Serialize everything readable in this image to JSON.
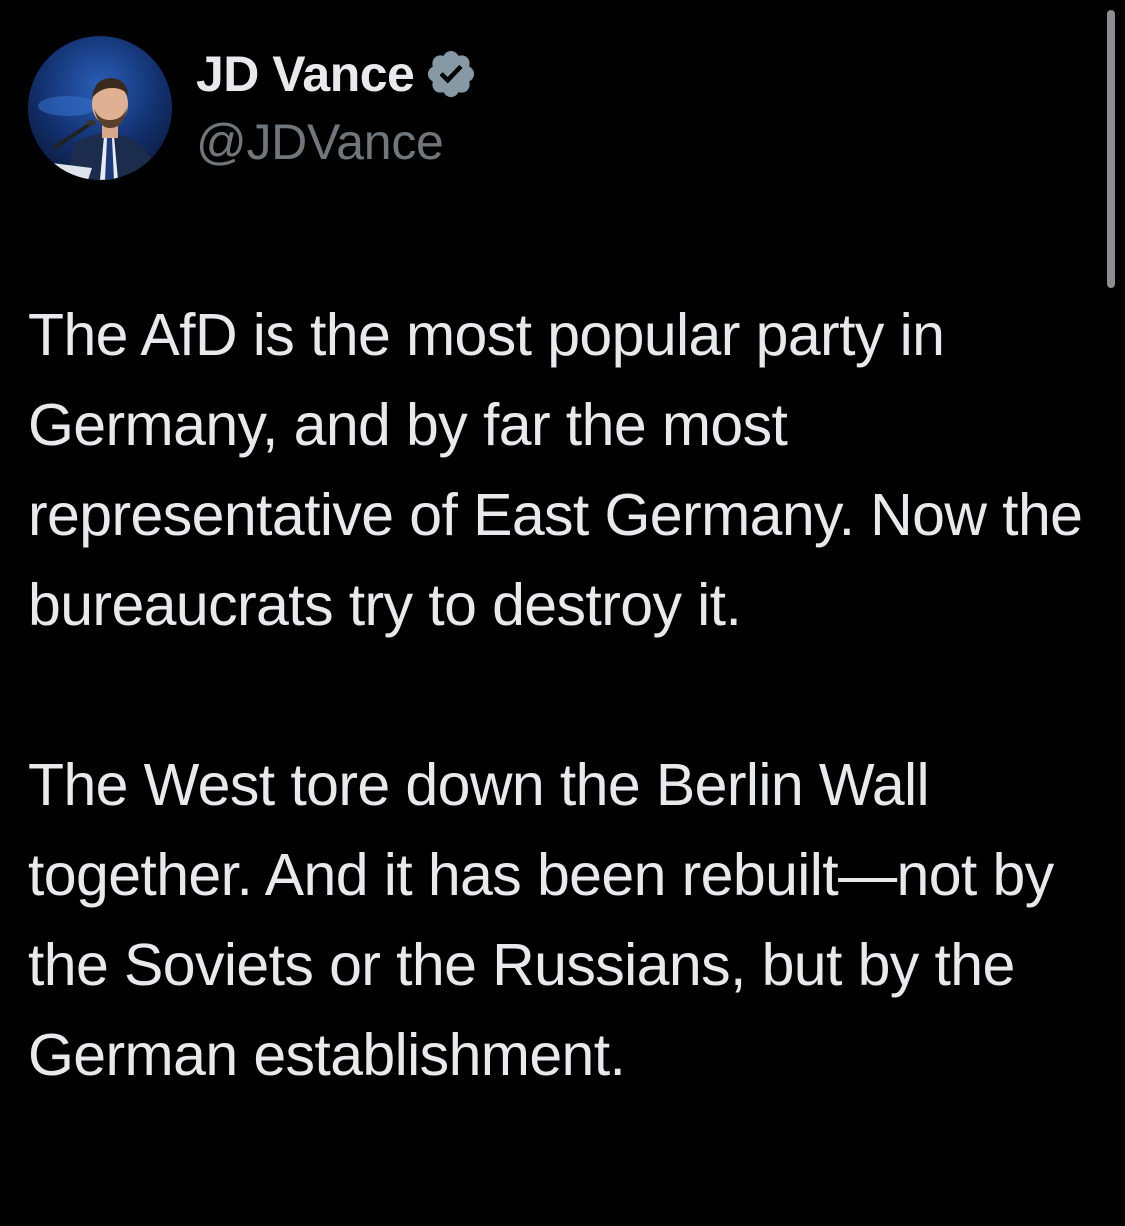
{
  "author": {
    "display_name": "JD Vance",
    "handle": "@JDVance",
    "verified_icon": "verified-badge-icon",
    "verified_color": "#8899a6",
    "avatar": "profile-photo-avatar"
  },
  "tweet": {
    "paragraphs": [
      "The AfD is the most popular party in Germany, and by far the most representative of East Germany. Now the bureaucrats try to destroy it.",
      "The West tore down the Berlin Wall together. And it has been rebuilt—not by the Soviets or the Russians, but by the German establishment."
    ]
  },
  "colors": {
    "background": "#000000",
    "primary_text": "#e7e9ea",
    "secondary_text": "#71767b"
  }
}
